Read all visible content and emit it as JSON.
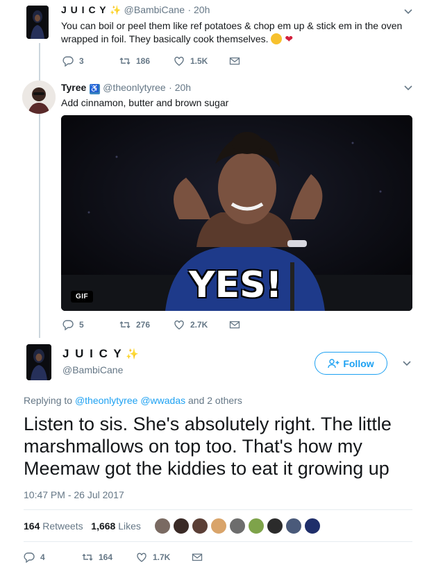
{
  "tweet1": {
    "name": "J U I C Y",
    "handle": "@BambiCane",
    "time": "· 20h",
    "text": "You can boil or peel them like ref potatoes & chop em up & stick em in the oven wrapped in foil. They basically cook themselves.",
    "replies": "3",
    "retweets": "186",
    "likes": "1.5K"
  },
  "tweet2": {
    "name": "Tyree",
    "handle": "@theonlytyree",
    "time": "· 20h",
    "text": "Add cinnamon, butter and brown sugar",
    "gif_label": "GIF",
    "gif_caption": "YES!",
    "replies": "5",
    "retweets": "276",
    "likes": "2.7K"
  },
  "main": {
    "name": "J U I C Y",
    "handle": "@BambiCane",
    "follow_label": "Follow",
    "replying_prefix": "Replying to",
    "reply_to_1": "@theonlytyree",
    "reply_to_2": "@wwadas",
    "reply_suffix": "and 2 others",
    "text": "Listen to sis. She's absolutely right. The little marshmallows on top too. That's how my Meemaw got the kiddies to eat it growing up",
    "timestamp": "10:47 PM - 26 Jul 2017",
    "retweets_count": "164",
    "retweets_label": "Retweets",
    "likes_count": "1,668",
    "likes_label": "Likes",
    "replies": "4",
    "retweets": "164",
    "likes": "1.7K"
  },
  "colors": {
    "accent": "#1da1f2",
    "muted": "#657786",
    "divider": "#e6ecf0"
  }
}
